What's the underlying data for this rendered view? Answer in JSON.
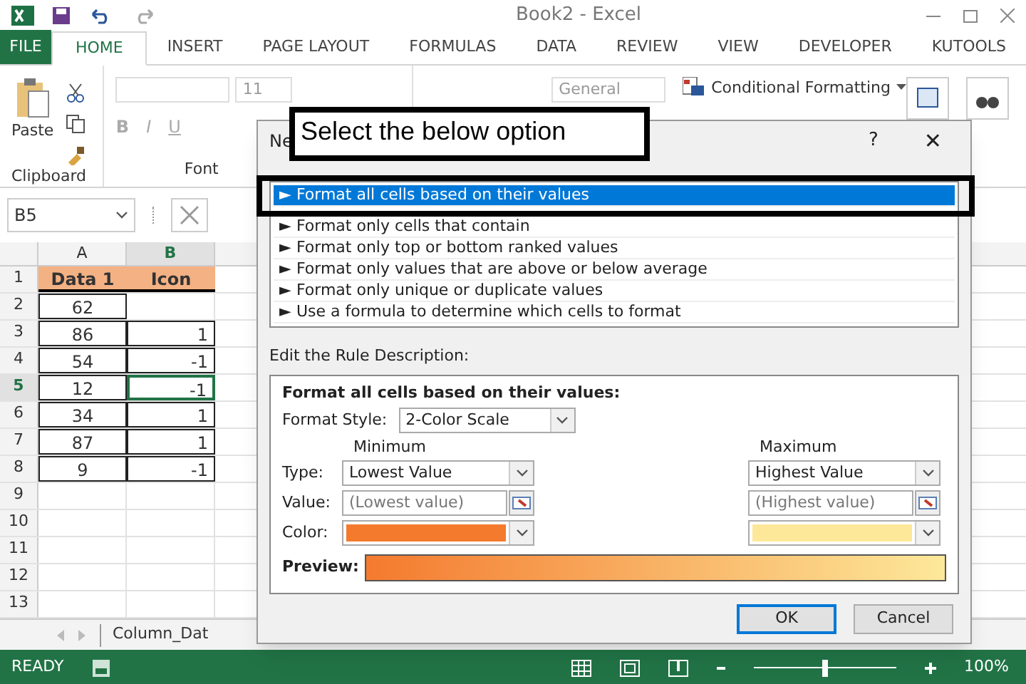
{
  "window": {
    "title": "Book2 - Excel"
  },
  "ribbon_tabs": [
    {
      "label": "FILE",
      "kind": "file",
      "selected": false
    },
    {
      "label": "HOME",
      "kind": "tab",
      "selected": true
    },
    {
      "label": "INSERT",
      "kind": "tab",
      "selected": false
    },
    {
      "label": "PAGE LAYOUT",
      "kind": "tab",
      "selected": false
    },
    {
      "label": "FORMULAS",
      "kind": "tab",
      "selected": false
    },
    {
      "label": "DATA",
      "kind": "tab",
      "selected": false
    },
    {
      "label": "REVIEW",
      "kind": "tab",
      "selected": false
    },
    {
      "label": "VIEW",
      "kind": "tab",
      "selected": false
    },
    {
      "label": "DEVELOPER",
      "kind": "tab",
      "selected": false
    },
    {
      "label": "KUTOOLS",
      "kind": "tab",
      "selected": false
    }
  ],
  "ribbon": {
    "paste": "Paste",
    "font_size": "11",
    "font_buttons": [
      "B",
      "I",
      "U"
    ],
    "number_format": "General",
    "conditional_formatting": "Conditional Formatting",
    "groups": [
      "Clipboard",
      "Font"
    ]
  },
  "name_box": "B5",
  "columns": [
    {
      "label": "A",
      "selected": false
    },
    {
      "label": "B",
      "selected": true
    }
  ],
  "rows": [
    {
      "number": "1",
      "a": "Data 1",
      "b": "Icon",
      "header": true,
      "selected": false
    },
    {
      "number": "2",
      "a": "62",
      "b": "",
      "header": false,
      "selected": false
    },
    {
      "number": "3",
      "a": "86",
      "b": "1",
      "header": false,
      "selected": false
    },
    {
      "number": "4",
      "a": "54",
      "b": "-1",
      "header": false,
      "selected": false
    },
    {
      "number": "5",
      "a": "12",
      "b": "-1",
      "header": false,
      "selected": true
    },
    {
      "number": "6",
      "a": "34",
      "b": "1",
      "header": false,
      "selected": false
    },
    {
      "number": "7",
      "a": "87",
      "b": "1",
      "header": false,
      "selected": false
    },
    {
      "number": "8",
      "a": "9",
      "b": "-1",
      "header": false,
      "selected": false
    },
    {
      "number": "9",
      "selected": false
    },
    {
      "number": "10",
      "selected": false
    },
    {
      "number": "11",
      "selected": false
    },
    {
      "number": "12",
      "selected": false
    },
    {
      "number": "13",
      "selected": false
    }
  ],
  "sheet_tab": "Column_Dat",
  "status_bar": {
    "status": "READY",
    "zoom": "100%",
    "zoom_slider": {
      "level": 0.5
    }
  },
  "dialog": {
    "title": "Ne",
    "help": "?",
    "close": "✕",
    "rule_types": [
      {
        "label": "► Format all cells based on their values",
        "selected": true
      },
      {
        "label": "► Format only cells that contain",
        "selected": false
      },
      {
        "label": "► Format only top or bottom ranked values",
        "selected": false
      },
      {
        "label": "► Format only values that are above or below average",
        "selected": false
      },
      {
        "label": "► Format only unique or duplicate values",
        "selected": false
      },
      {
        "label": "► Use a formula to determine which cells to format",
        "selected": false
      }
    ],
    "description_label": "Edit the Rule Description:",
    "description_title": "Format all cells based on their values:",
    "format_style_label": "Format Style:",
    "format_style": "2-Color Scale",
    "minimum": {
      "heading": "Minimum",
      "type": "Lowest Value",
      "value_placeholder": "(Lowest value)",
      "color": "#f47a2e"
    },
    "maximum": {
      "heading": "Maximum",
      "type": "Highest Value",
      "value_placeholder": "(Highest value)",
      "color": "#fde89a"
    },
    "row_labels": [
      "Type:",
      "Value:",
      "Color:"
    ],
    "preview_label": "Preview:",
    "buttons": [
      "OK",
      "Cancel"
    ]
  },
  "annotation": {
    "text": "Select the below option"
  }
}
